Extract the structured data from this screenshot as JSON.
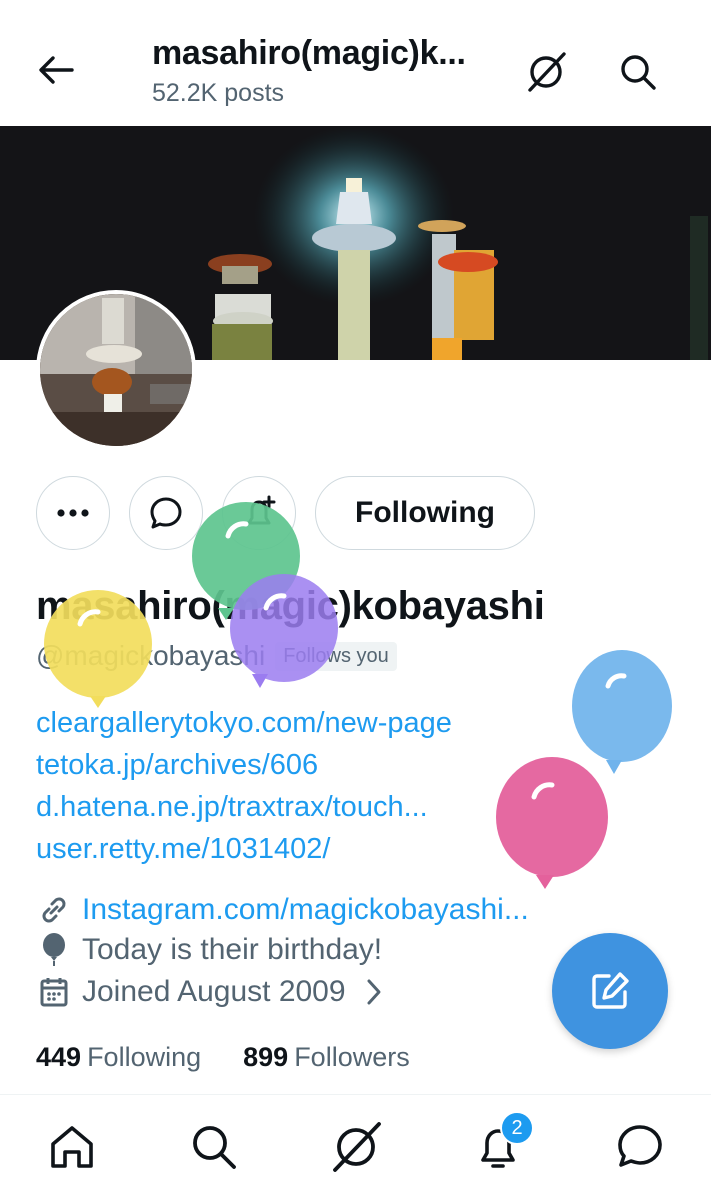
{
  "header": {
    "title": "masahiro(magic)k...",
    "subtitle": "52.2K posts"
  },
  "actions": {
    "following_label": "Following"
  },
  "profile": {
    "display_name": "masahiro(magic)kobayashi",
    "handle": "@magickobayashi",
    "follows_you": "Follows you",
    "bio_links": [
      "cleargallerytokyo.com/new-page",
      "tetoka.jp/archives/606",
      "d.hatena.ne.jp/traxtrax/touch...",
      "user.retty.me/1031402/"
    ],
    "website": "Instagram.com/magickobayashi...",
    "birthday": "Today is their birthday!",
    "joined": "Joined August 2009",
    "following_count": "449",
    "following_label": "Following",
    "followers_count": "899",
    "followers_label": "Followers"
  },
  "balloons": [
    {
      "color": "#f2dd5c",
      "name": "yellow"
    },
    {
      "color": "#5dc48e",
      "name": "green"
    },
    {
      "color": "#9b7cf0",
      "name": "purple"
    },
    {
      "color": "#6fb3ec",
      "name": "blue"
    },
    {
      "color": "#e4619c",
      "name": "pink"
    }
  ],
  "nav": {
    "items": [
      "home-icon",
      "search-icon",
      "grok-icon",
      "notifications-icon",
      "messages-icon"
    ],
    "notification_badge": "2"
  },
  "colors": {
    "accent": "#1d9bf0",
    "fab": "#3f93e0",
    "text_secondary": "#536471"
  }
}
